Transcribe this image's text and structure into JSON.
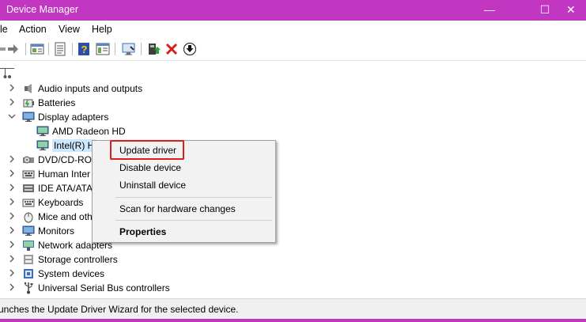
{
  "window": {
    "title": "Device Manager",
    "minimize": "—",
    "maximize": "☐",
    "close": "✕",
    "accent": "#c137c1"
  },
  "menubar": {
    "items": [
      "le",
      "Action",
      "View",
      "Help"
    ]
  },
  "toolbar": {
    "icons": [
      "back-arrow-icon",
      "forward-arrow-icon",
      "show-hide-console-tree-icon",
      "properties-icon",
      "help-icon",
      "action-pane-icon",
      "scan-hardware-icon",
      "enable-device-icon",
      "uninstall-device-icon",
      "update-driver-icon"
    ]
  },
  "tree": {
    "nodes": [
      {
        "label": "Audio inputs and outputs",
        "icon": "speaker-icon"
      },
      {
        "label": "Batteries",
        "icon": "battery-icon"
      },
      {
        "label": "Display adapters",
        "icon": "monitor-icon",
        "expanded": true
      },
      {
        "label": "AMD Radeon HD",
        "icon": "display-adapter-icon"
      },
      {
        "label": "Intel(R) H",
        "icon": "display-adapter-icon",
        "selected": true
      },
      {
        "label": "DVD/CD-ROI",
        "icon": "dvd-drive-icon"
      },
      {
        "label": "Human Inter",
        "icon": "hid-icon"
      },
      {
        "label": "IDE ATA/ATA",
        "icon": "ide-controller-icon"
      },
      {
        "label": "Keyboards",
        "icon": "keyboard-icon"
      },
      {
        "label": "Mice and oth",
        "icon": "mouse-icon"
      },
      {
        "label": "Monitors",
        "icon": "monitor-icon"
      },
      {
        "label": "Network adapters",
        "icon": "network-adapter-icon"
      },
      {
        "label": "Storage controllers",
        "icon": "storage-controller-icon"
      },
      {
        "label": "System devices",
        "icon": "system-device-icon"
      },
      {
        "label": "Universal Serial Bus controllers",
        "icon": "usb-icon"
      }
    ]
  },
  "context_menu": {
    "items": [
      "Update driver",
      "Disable device",
      "Uninstall device",
      "Scan for hardware changes",
      "Properties"
    ],
    "highlight_color": "#d81e1e"
  },
  "statusbar": {
    "text": "unches the Update Driver Wizard for the selected device."
  }
}
